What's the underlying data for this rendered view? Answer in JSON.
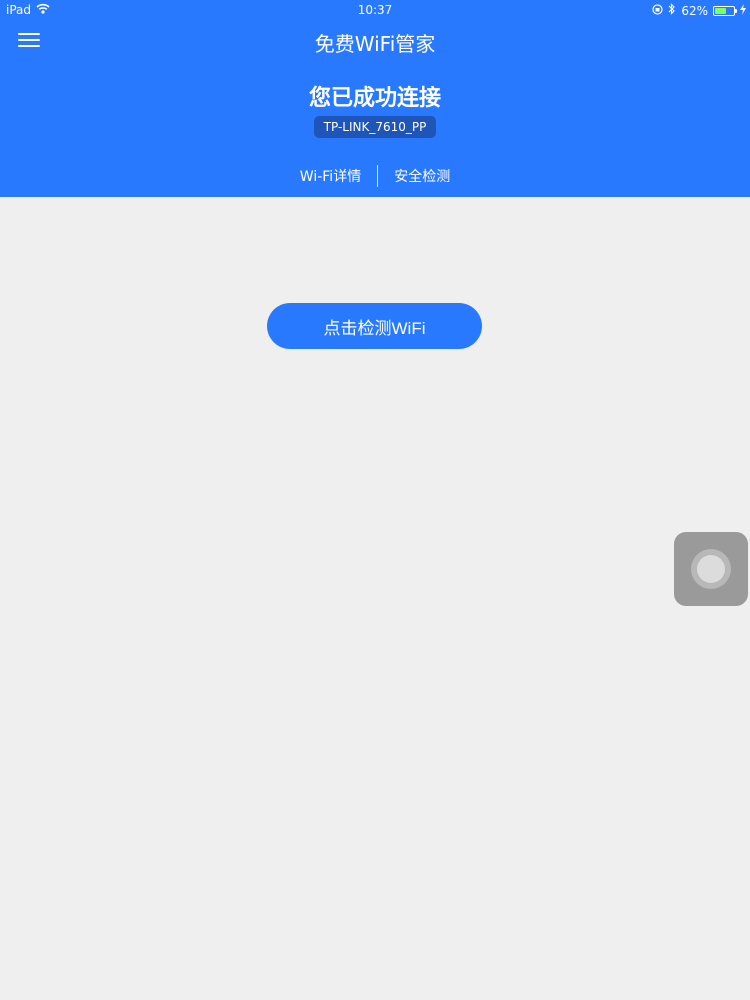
{
  "status_bar": {
    "device": "iPad",
    "time": "10:37",
    "battery_percent_text": "62%",
    "battery_level": 0.62,
    "icons": [
      "wifi-icon",
      "orientation-lock-icon",
      "bluetooth-icon",
      "battery-icon",
      "charging-icon"
    ]
  },
  "nav": {
    "title": "免费WiFi管家",
    "menu_icon": "hamburger-menu-icon"
  },
  "connection": {
    "headline": "您已成功连接",
    "ssid": "TP-LINK_7610_PP"
  },
  "tabs": [
    {
      "label": "Wi-Fi详情"
    },
    {
      "label": "安全检测"
    }
  ],
  "main": {
    "check_button_label": "点击检测WiFi"
  },
  "colors": {
    "brand_blue": "#2979ff",
    "badge_blue": "#1f55b8",
    "background": "#efefef",
    "assistive_touch": "#9a9a9a"
  }
}
